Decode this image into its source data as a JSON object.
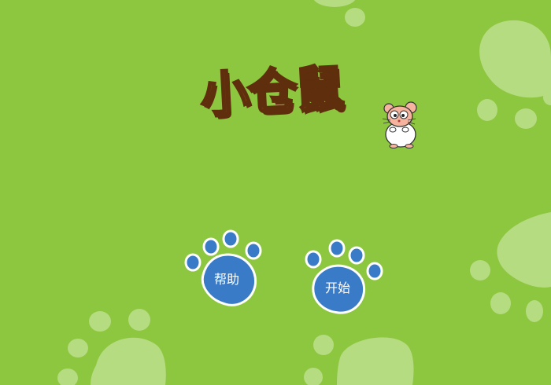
{
  "game": {
    "title": "小仓鼠",
    "buttons": {
      "help_label": "帮助",
      "start_label": "开始"
    }
  },
  "colors": {
    "background": "#8dc63f",
    "paw_print_decor": "#b5dc80",
    "paw_button_fill": "#3a7bc8",
    "paw_button_border": "#ffffff",
    "title_fill": "#a4561f",
    "title_outline": "#5e2e0d"
  },
  "icons": {
    "mascot": "hamster-icon",
    "help_button": "paw-print-icon",
    "start_button": "paw-print-icon",
    "decor": "paw-print-icon"
  }
}
